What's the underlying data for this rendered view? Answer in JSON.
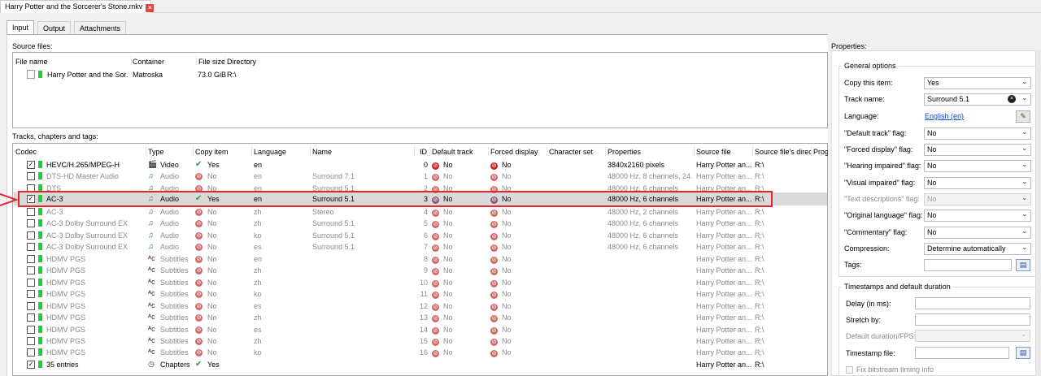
{
  "file_tab": {
    "title": "Harry Potter and the Sorcerer's Stone.mkv"
  },
  "tabs": [
    {
      "label": "Input",
      "active": true
    },
    {
      "label": "Output",
      "active": false
    },
    {
      "label": "Attachments",
      "active": false
    }
  ],
  "source_files": {
    "label": "Source files:",
    "headers": [
      "File name",
      "Container",
      "File size",
      "Directory"
    ],
    "rows": [
      {
        "name": "Harry Potter and the Sor...",
        "container": "Matroska",
        "size": "73.0 GiB",
        "directory": "R:\\"
      }
    ]
  },
  "tracks": {
    "label": "Tracks, chapters and tags:",
    "headers": [
      "Codec",
      "Type",
      "Copy item",
      "Language",
      "Name",
      "ID",
      "Default track",
      "Forced display",
      "Character set",
      "Properties",
      "Source file",
      "Source file's direc",
      "Prog"
    ],
    "rows": [
      {
        "checked": true,
        "codec": "HEVC/H.265/MPEG-H",
        "type": "Video",
        "type_icon": "video-icon",
        "copy": "Yes",
        "lang": "en",
        "name": "",
        "id": "0",
        "default": "No",
        "forced": "No",
        "props": "3840x2160 pixels",
        "src": "Harry Potter an...",
        "dir": "R:\\",
        "dim": false
      },
      {
        "checked": false,
        "codec": "DTS-HD Master Audio",
        "type": "Audio",
        "type_icon": "audio-icon",
        "copy": "No",
        "lang": "en",
        "name": "Surround 7.1",
        "id": "1",
        "default": "No",
        "forced": "No",
        "props": "48000 Hz, 8 channels, 24...",
        "src": "Harry Potter an...",
        "dir": "R:\\",
        "dim": true
      },
      {
        "checked": false,
        "codec": "DTS",
        "type": "Audio",
        "type_icon": "audio-icon",
        "copy": "No",
        "lang": "en",
        "name": "Surround 5.1",
        "id": "2",
        "default": "No",
        "forced": "No",
        "props": "48000 Hz, 6 channels",
        "src": "Harry Potter an...",
        "dir": "R:\\",
        "dim": true
      },
      {
        "checked": true,
        "codec": "AC-3",
        "type": "Audio",
        "type_icon": "audio-icon",
        "copy": "Yes",
        "lang": "en",
        "name": "Surround 5.1",
        "id": "3",
        "default": "No",
        "forced": "No",
        "props": "48000 Hz, 6 channels",
        "src": "Harry Potter an...",
        "dir": "R:\\",
        "dim": false,
        "selected": true
      },
      {
        "checked": false,
        "codec": "AC-3",
        "type": "Audio",
        "type_icon": "audio-icon",
        "copy": "No",
        "lang": "zh",
        "name": "Stereo",
        "id": "4",
        "default": "No",
        "forced": "No",
        "props": "48000 Hz, 2 channels",
        "src": "Harry Potter an...",
        "dir": "R:\\",
        "dim": true
      },
      {
        "checked": false,
        "codec": "AC-3 Dolby Surround EX",
        "type": "Audio",
        "type_icon": "audio-icon",
        "copy": "No",
        "lang": "zh",
        "name": "Surround 5.1",
        "id": "5",
        "default": "No",
        "forced": "No",
        "props": "48000 Hz, 6 channels",
        "src": "Harry Potter an...",
        "dir": "R:\\",
        "dim": true
      },
      {
        "checked": false,
        "codec": "AC-3 Dolby Surround EX",
        "type": "Audio",
        "type_icon": "audio-icon",
        "copy": "No",
        "lang": "ko",
        "name": "Surround 5.1",
        "id": "6",
        "default": "No",
        "forced": "No",
        "props": "48000 Hz, 6 channels",
        "src": "Harry Potter an...",
        "dir": "R:\\",
        "dim": true
      },
      {
        "checked": false,
        "codec": "AC-3 Dolby Surround EX",
        "type": "Audio",
        "type_icon": "audio-icon",
        "copy": "No",
        "lang": "es",
        "name": "Surround 5.1",
        "id": "7",
        "default": "No",
        "forced": "No",
        "props": "48000 Hz, 6 channels",
        "src": "Harry Potter an...",
        "dir": "R:\\",
        "dim": true
      },
      {
        "checked": false,
        "codec": "HDMV PGS",
        "type": "Subtitles",
        "type_icon": "subtitles-icon",
        "copy": "No",
        "lang": "en",
        "name": "",
        "id": "8",
        "default": "No",
        "forced": "No",
        "props": "",
        "src": "Harry Potter an...",
        "dir": "R:\\",
        "dim": true
      },
      {
        "checked": false,
        "codec": "HDMV PGS",
        "type": "Subtitles",
        "type_icon": "subtitles-icon",
        "copy": "No",
        "lang": "zh",
        "name": "",
        "id": "9",
        "default": "No",
        "forced": "No",
        "props": "",
        "src": "Harry Potter an...",
        "dir": "R:\\",
        "dim": true
      },
      {
        "checked": false,
        "codec": "HDMV PGS",
        "type": "Subtitles",
        "type_icon": "subtitles-icon",
        "copy": "No",
        "lang": "zh",
        "name": "",
        "id": "10",
        "default": "No",
        "forced": "No",
        "props": "",
        "src": "Harry Potter an...",
        "dir": "R:\\",
        "dim": true
      },
      {
        "checked": false,
        "codec": "HDMV PGS",
        "type": "Subtitles",
        "type_icon": "subtitles-icon",
        "copy": "No",
        "lang": "ko",
        "name": "",
        "id": "11",
        "default": "No",
        "forced": "No",
        "props": "",
        "src": "Harry Potter an...",
        "dir": "R:\\",
        "dim": true
      },
      {
        "checked": false,
        "codec": "HDMV PGS",
        "type": "Subtitles",
        "type_icon": "subtitles-icon",
        "copy": "No",
        "lang": "es",
        "name": "",
        "id": "12",
        "default": "No",
        "forced": "No",
        "props": "",
        "src": "Harry Potter an...",
        "dir": "R:\\",
        "dim": true
      },
      {
        "checked": false,
        "codec": "HDMV PGS",
        "type": "Subtitles",
        "type_icon": "subtitles-icon",
        "copy": "No",
        "lang": "zh",
        "name": "",
        "id": "13",
        "default": "No",
        "forced": "No",
        "props": "",
        "src": "Harry Potter an...",
        "dir": "R:\\",
        "dim": true
      },
      {
        "checked": false,
        "codec": "HDMV PGS",
        "type": "Subtitles",
        "type_icon": "subtitles-icon",
        "copy": "No",
        "lang": "es",
        "name": "",
        "id": "14",
        "default": "No",
        "forced": "No",
        "props": "",
        "src": "Harry Potter an...",
        "dir": "R:\\",
        "dim": true
      },
      {
        "checked": false,
        "codec": "HDMV PGS",
        "type": "Subtitles",
        "type_icon": "subtitles-icon",
        "copy": "No",
        "lang": "zh",
        "name": "",
        "id": "15",
        "default": "No",
        "forced": "No",
        "props": "",
        "src": "Harry Potter an...",
        "dir": "R:\\",
        "dim": true
      },
      {
        "checked": false,
        "codec": "HDMV PGS",
        "type": "Subtitles",
        "type_icon": "subtitles-icon",
        "copy": "No",
        "lang": "ko",
        "name": "",
        "id": "16",
        "default": "No",
        "forced": "No",
        "props": "",
        "src": "Harry Potter an...",
        "dir": "R:\\",
        "dim": true
      },
      {
        "checked": true,
        "codec": "35 entries",
        "type": "Chapters",
        "type_icon": "chapters-icon",
        "copy": "Yes",
        "lang": "",
        "name": "",
        "id": "",
        "default": "",
        "forced": "",
        "props": "",
        "src": "Harry Potter an...",
        "dir": "R:\\",
        "dim": false
      }
    ]
  },
  "properties": {
    "label": "Properties:",
    "general_title": "General options",
    "fields": [
      {
        "label": "Copy this item:",
        "value": "Yes",
        "kind": "select"
      },
      {
        "label": "Track name:",
        "value": "Surround 5.1",
        "kind": "combo"
      },
      {
        "label": "Language:",
        "value": "English (en)",
        "kind": "link"
      },
      {
        "label": "\"Default track\" flag:",
        "value": "No",
        "kind": "select"
      },
      {
        "label": "\"Forced display\" flag:",
        "value": "No",
        "kind": "select"
      },
      {
        "label": "\"Hearing impaired\" flag:",
        "value": "No",
        "kind": "select"
      },
      {
        "label": "\"Visual impaired\" flag:",
        "value": "No",
        "kind": "select"
      },
      {
        "label": "\"Text descriptions\" flag:",
        "value": "No",
        "kind": "select-disabled"
      },
      {
        "label": "\"Original language\" flag:",
        "value": "No",
        "kind": "select"
      },
      {
        "label": "\"Commentary\" flag:",
        "value": "No",
        "kind": "select"
      },
      {
        "label": "Compression:",
        "value": "Determine automatically",
        "kind": "select"
      },
      {
        "label": "Tags:",
        "value": "",
        "kind": "file"
      }
    ],
    "timestamps_title": "Timestamps and default duration",
    "ts_fields": [
      {
        "label": "Delay (in ms):",
        "value": ""
      },
      {
        "label": "Stretch by:",
        "value": ""
      },
      {
        "label": "Default duration/FPS:",
        "value": ""
      },
      {
        "label": "Timestamp file:",
        "value": ""
      }
    ],
    "fix_bitstream": "Fix bitstream timing info"
  },
  "colors": {
    "selection_outline": "#e3262e",
    "status_green": "#19d23a"
  }
}
